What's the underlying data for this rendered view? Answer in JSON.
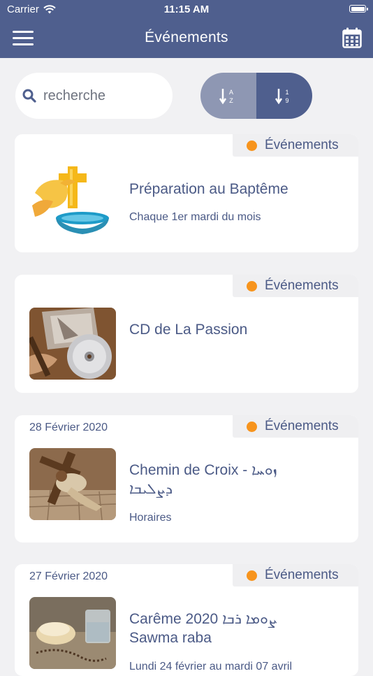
{
  "status_bar": {
    "carrier": "Carrier",
    "time": "11:15 AM"
  },
  "nav": {
    "title": "Événements"
  },
  "search": {
    "placeholder": "recherche"
  },
  "sort": {
    "alpha_top": "A",
    "alpha_bottom": "Z",
    "num_top": "1",
    "num_bottom": "9"
  },
  "colors": {
    "nav_bg": "#4f5f8e",
    "accent_dot": "#f7941d",
    "text": "#4b5a86",
    "background": "#f1f1f3"
  },
  "events": [
    {
      "date": "",
      "badge": "Événements",
      "title": "Préparation au Baptême",
      "title_extra": "",
      "subtitle": "Chaque 1er mardi du mois",
      "image": "baptism-dove-cross-icon"
    },
    {
      "date": "",
      "badge": "Événements",
      "title": "CD de La Passion",
      "title_extra": "",
      "subtitle": "",
      "image": "cd-passion-photo"
    },
    {
      "date": "28 Février 2020",
      "badge": "Événements",
      "title": "Chemin de Croix - ܙܘܚܐ",
      "title_extra": "ܕܨܠܝܒܐ",
      "subtitle": "Horaires",
      "image": "way-of-cross-photo"
    },
    {
      "date": "27 Février 2020",
      "badge": "Événements",
      "title": "Carême 2020 ܨܘܡܐ ܪܒܐ",
      "title_extra": "Sawma raba",
      "subtitle": "Lundi 24 février au mardi 07 avril",
      "image": "bread-water-rosary-photo"
    }
  ]
}
